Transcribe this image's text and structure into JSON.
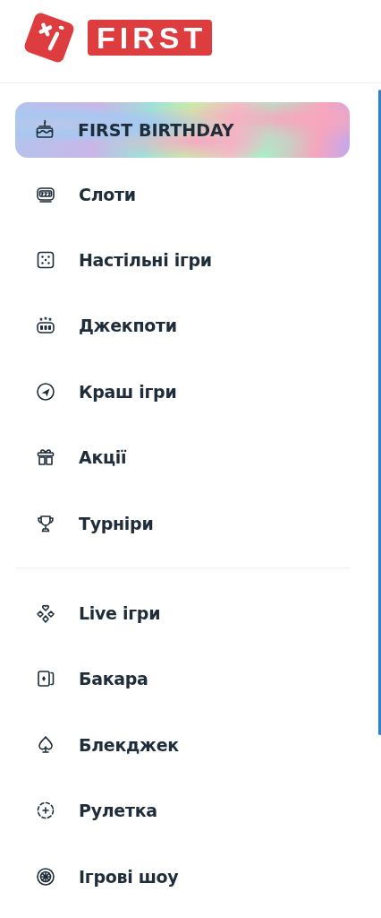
{
  "logo": {
    "text": "FIRST"
  },
  "featured_item": {
    "label": "FIRST BIRTHDAY"
  },
  "menu_groups": [
    {
      "items": [
        {
          "label": "Слоти"
        },
        {
          "label": "Настільні ігри"
        },
        {
          "label": "Джекпоти"
        },
        {
          "label": "Краш ігри"
        },
        {
          "label": "Акції"
        },
        {
          "label": "Турніри"
        }
      ]
    },
    {
      "items": [
        {
          "label": "Live ігри"
        },
        {
          "label": "Бакара"
        },
        {
          "label": "Блекджек"
        },
        {
          "label": "Рулетка"
        },
        {
          "label": "Ігрові шоу"
        }
      ]
    }
  ]
}
